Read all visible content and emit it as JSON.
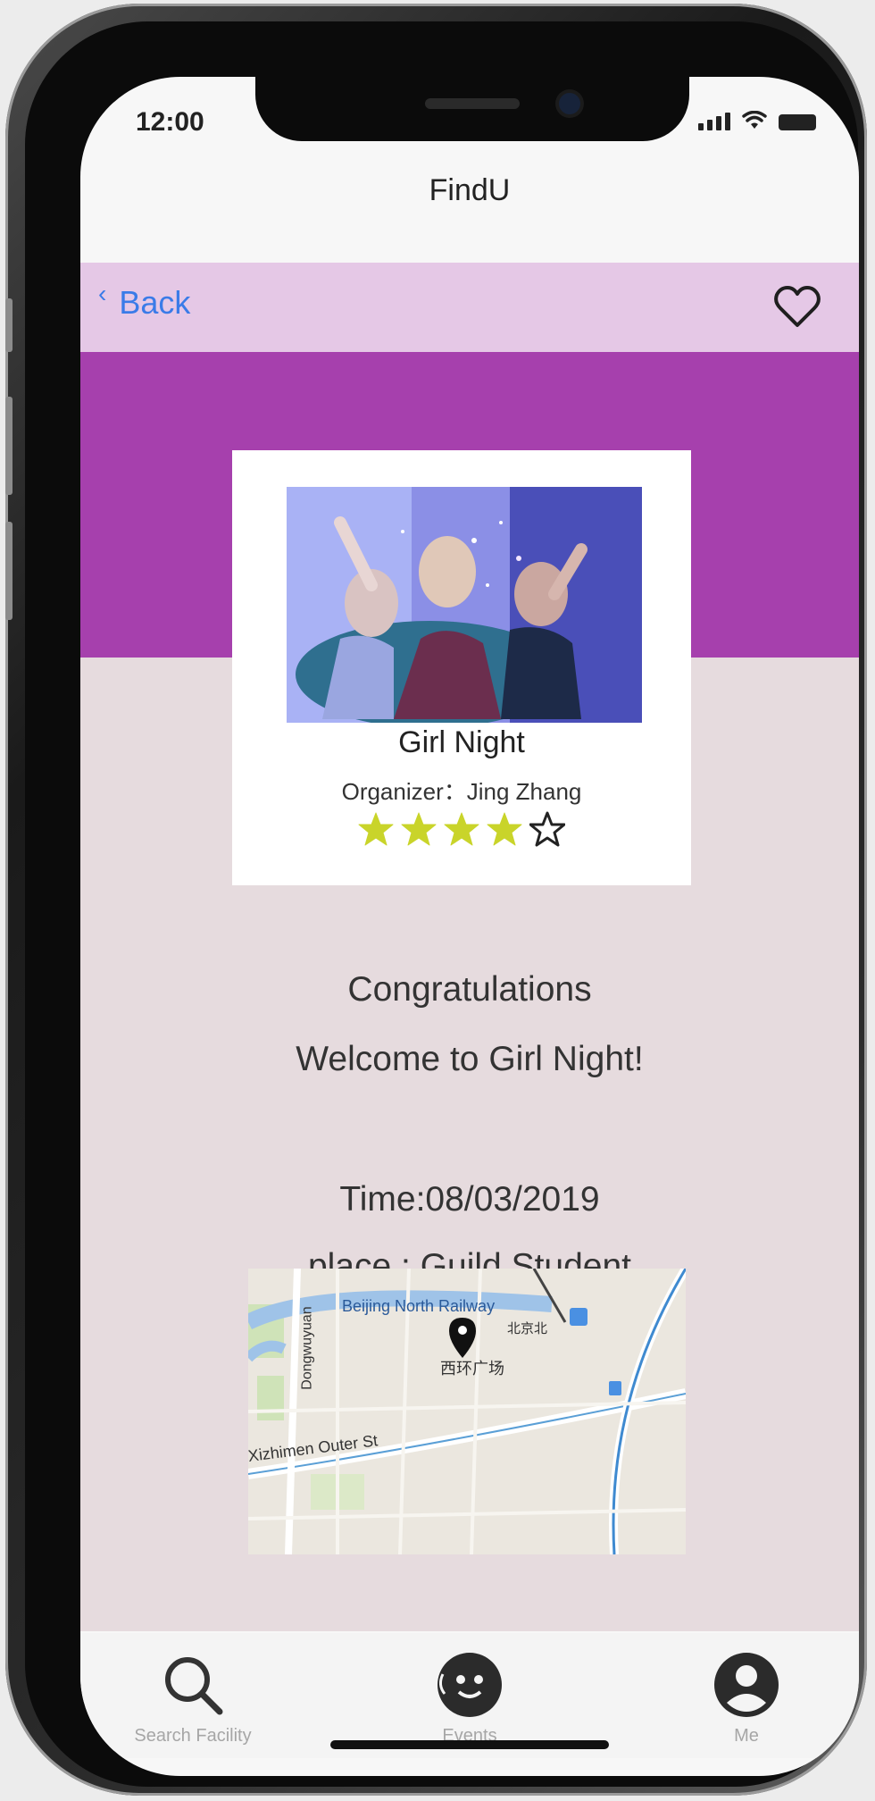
{
  "status_bar": {
    "time": "12:00"
  },
  "app": {
    "title": "FindU"
  },
  "nav": {
    "back_label": "Back"
  },
  "event": {
    "title": "Girl Night",
    "organizer": "Organizer：Jing Zhang",
    "rating": 4,
    "rating_max": 5
  },
  "message": {
    "line1": "Congratulations",
    "line2": "Welcome to Girl Night!"
  },
  "details": {
    "time": "Time:08/03/2019",
    "place": "place : Guild Student"
  },
  "map": {
    "label_station": "Beijing North Railway",
    "label_station_cn": "北京北",
    "label_plaza": "西环广场",
    "label_road": "Xizhimen Outer St",
    "label_vertical": "Dongwuyuan"
  },
  "tabs": [
    {
      "label": "Search Facility",
      "icon": "search-icon"
    },
    {
      "label": "Events",
      "icon": "events-icon"
    },
    {
      "label": "Me",
      "icon": "user-icon"
    }
  ],
  "colors": {
    "nav_bg": "#e5c8e6",
    "hero_bg": "#a640ad",
    "content_bg": "#e6dbde",
    "link_blue": "#3a7be8",
    "star_yellow": "#c9d42a"
  }
}
